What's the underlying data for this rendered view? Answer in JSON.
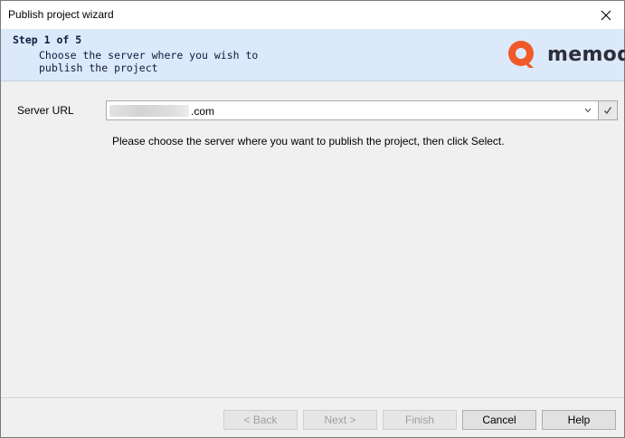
{
  "window": {
    "title": "Publish project wizard"
  },
  "header": {
    "step": "Step 1 of 5",
    "description": "Choose the server where you wish to publish the project",
    "logo_text": "memoq",
    "brand_color": "#f05a28"
  },
  "form": {
    "server_label": "Server URL",
    "server_value": ".com",
    "hint": "Please choose the server where you want to publish the project, then click Select."
  },
  "footer": {
    "back": "< Back",
    "next": "Next >",
    "finish": "Finish",
    "cancel": "Cancel",
    "help": "Help"
  }
}
